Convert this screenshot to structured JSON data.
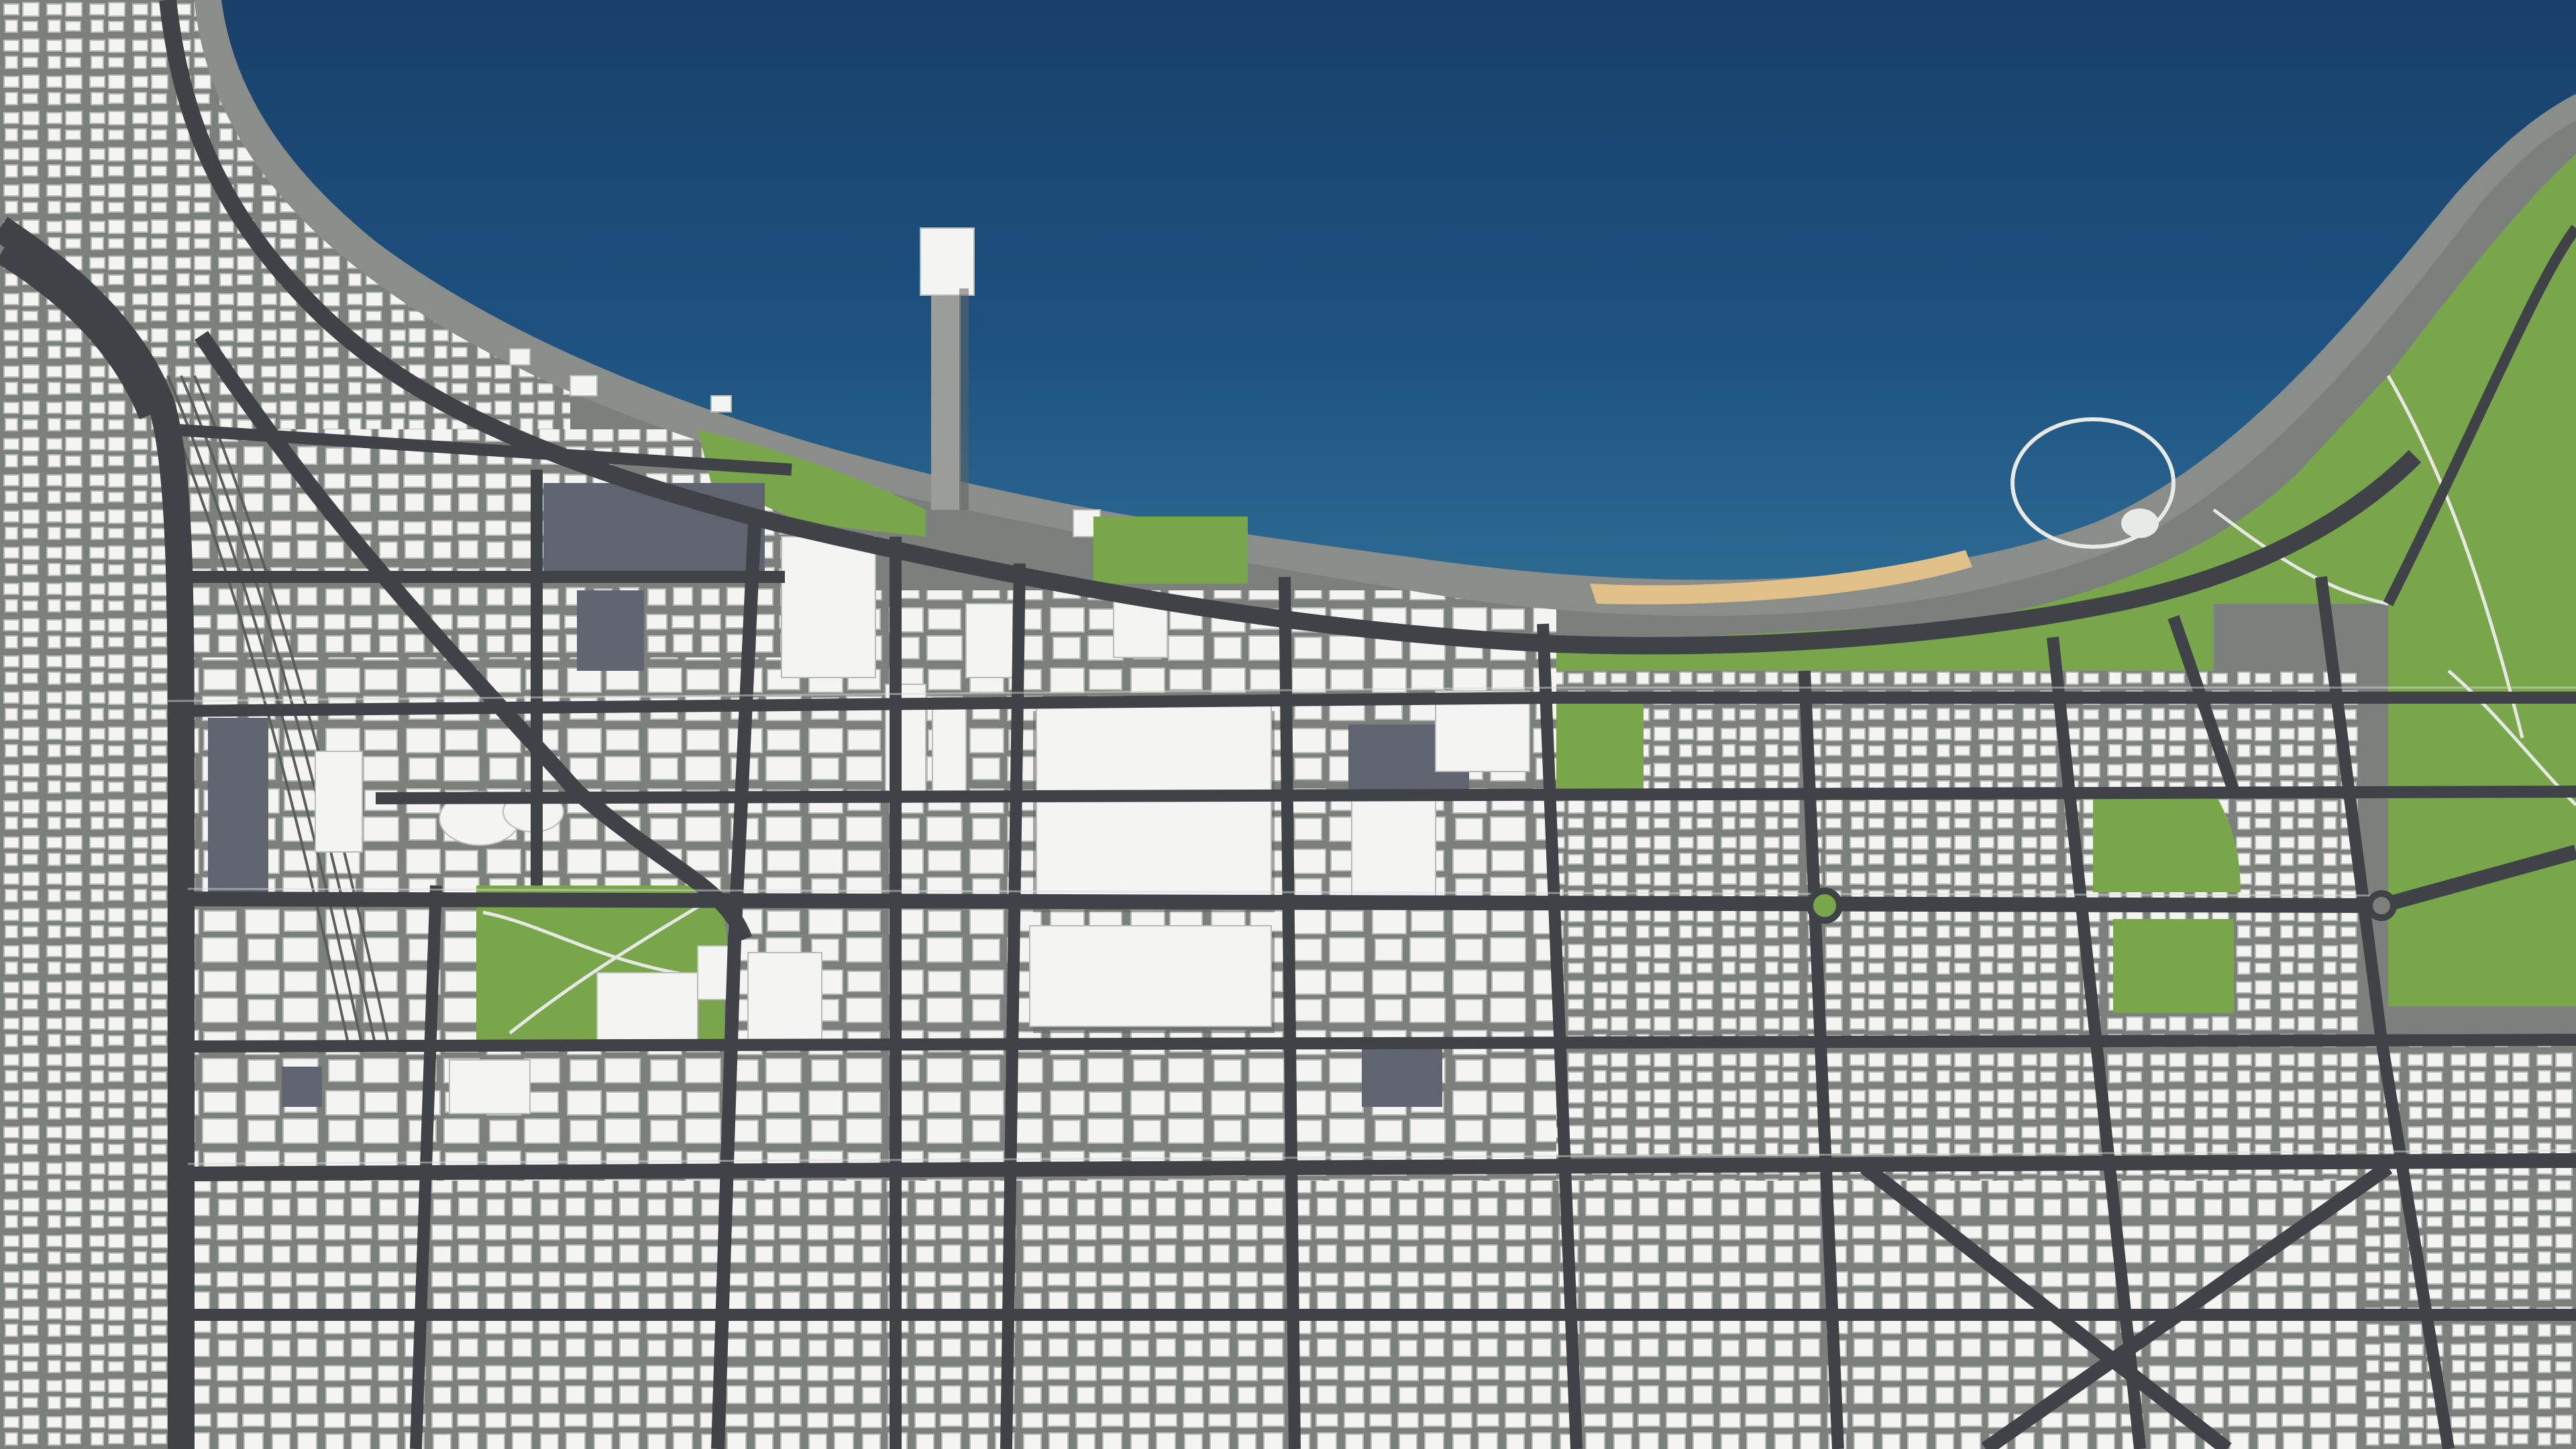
{
  "colors": {
    "water_deep": "#1a4670",
    "water_shallow": "#2c6a92",
    "shore": "#8a8e8a",
    "beach": "#e2c08a",
    "ground": "#7c807c",
    "street": "#3f4347",
    "curb": "#d8d9d6",
    "park": "#79a64a",
    "building": "#f4f4f2",
    "parking": "#5f6470"
  },
  "features": {
    "water_body": "lake",
    "pier": "pier",
    "beach": "beach",
    "parks": [
      "waterfront-park",
      "lakeshore-park",
      "central-park",
      "east-park-north",
      "east-park-south"
    ],
    "rail_yard": "rail-yard",
    "highway": "highway"
  }
}
